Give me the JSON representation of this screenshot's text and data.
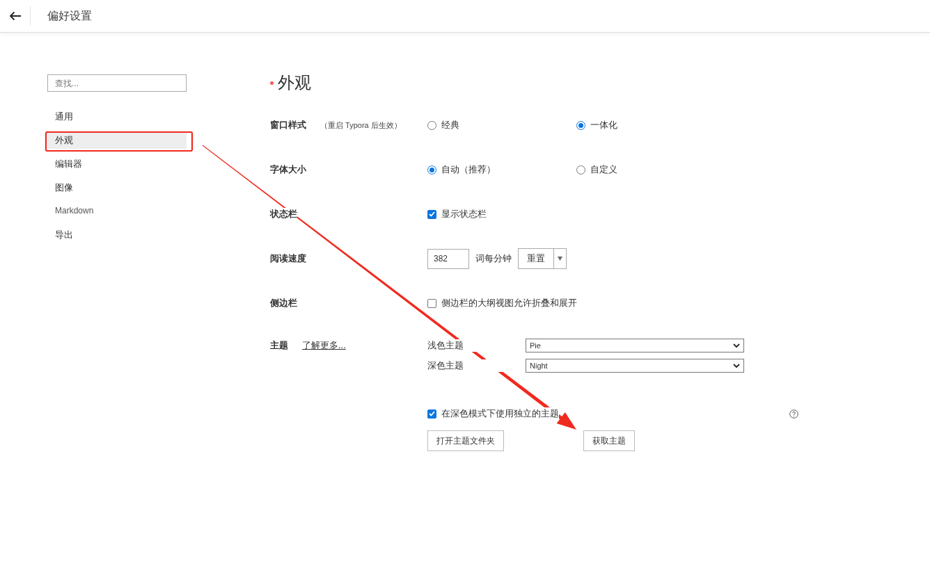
{
  "header": {
    "title": "偏好设置"
  },
  "sidebar": {
    "search": {
      "placeholder": "查找..."
    },
    "items": [
      {
        "label": "通用",
        "selected": false
      },
      {
        "label": "外观",
        "selected": true
      },
      {
        "label": "编辑器",
        "selected": false
      },
      {
        "label": "图像",
        "selected": false
      },
      {
        "label": "Markdown",
        "selected": false
      },
      {
        "label": "导出",
        "selected": false
      }
    ]
  },
  "section": {
    "title": "外观"
  },
  "settings": [
    {
      "kind": "radio",
      "label": "窗口样式",
      "note": "（重启 Typora 后生效）",
      "options": [
        {
          "label": "经典",
          "selected": false
        },
        {
          "label": "一体化",
          "selected": true
        }
      ]
    },
    {
      "kind": "radio",
      "label": "字体大小",
      "options": [
        {
          "label": "自动（推荐）",
          "selected": true
        },
        {
          "label": "自定义",
          "selected": false
        }
      ]
    },
    {
      "kind": "checkbox",
      "label": "状态栏",
      "option": {
        "label": "显示状态栏",
        "checked": true
      }
    },
    {
      "kind": "number",
      "label": "阅读速度",
      "value": "382",
      "unit": "词每分钟",
      "button": "重置"
    },
    {
      "kind": "checkbox",
      "label": "侧边栏",
      "option": {
        "label": "侧边栏的大纲视图允许折叠和展开",
        "checked": false
      }
    },
    {
      "kind": "theme",
      "label": "主题",
      "link": "了解更多...",
      "selects": [
        {
          "label": "浅色主题",
          "value": "Pie"
        },
        {
          "label": "深色主题",
          "value": "Night"
        }
      ],
      "option": {
        "label": "在深色模式下使用独立的主题",
        "checked": true
      },
      "buttons": [
        "打开主题文件夹",
        "获取主题"
      ]
    }
  ]
}
